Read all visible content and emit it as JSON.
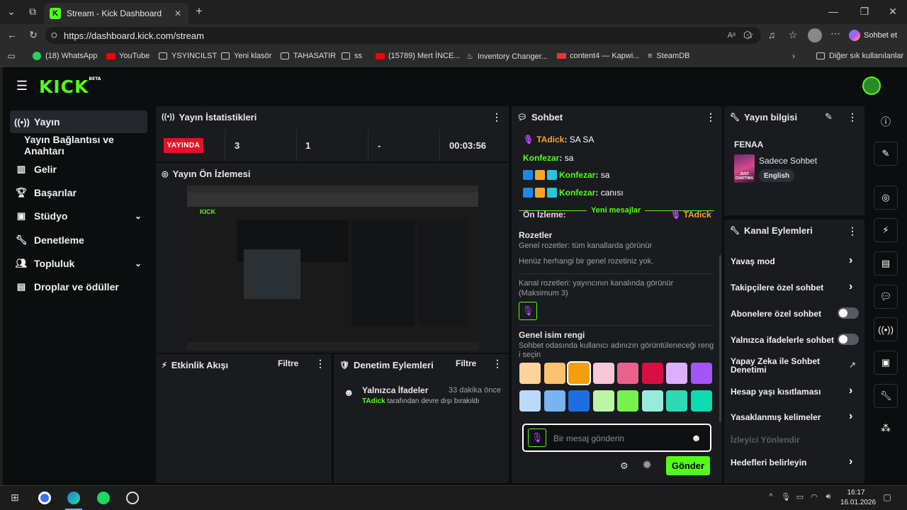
{
  "browser": {
    "tab_title": "Stream - Kick Dashboard",
    "url": "https://dashboard.kick.com/stream",
    "copilot_label": "Sohbet et",
    "bookmarks": [
      "(18) WhatsApp",
      "YouTube",
      "YSYINCILST",
      "Yeni klasör",
      "TAHASATIR",
      "ss",
      "(15789) Mert İNCE...",
      "Inventory Changer...",
      "content4 — Kapwi...",
      "SteamDB"
    ],
    "other_bookmarks": "Diğer sık kullanılanlar"
  },
  "logo": {
    "text": "KICK",
    "beta": "BETA"
  },
  "sidebar": {
    "items": [
      {
        "label": "Yayın",
        "icon": "broadcast-icon"
      },
      {
        "label": "Yayın Bağlantısı ve Anahtarı"
      },
      {
        "label": "Gelir",
        "icon": "chart-icon"
      },
      {
        "label": "Başarılar",
        "icon": "trophy-icon"
      },
      {
        "label": "Stüdyo",
        "icon": "studio-icon"
      },
      {
        "label": "Denetleme",
        "icon": "wrench-icon"
      },
      {
        "label": "Topluluk",
        "icon": "people-icon"
      },
      {
        "label": "Droplar ve ödüller",
        "icon": "gift-icon"
      }
    ]
  },
  "stats": {
    "title": "Yayın İstatistikleri",
    "live_label": "YAYINDA",
    "values": [
      "3",
      "1",
      "-",
      "00:03:56"
    ]
  },
  "preview": {
    "title": "Yayın Ön İzlemesi"
  },
  "activity": {
    "title": "Etkinlik Akışı",
    "filter": "Filtre"
  },
  "moderation": {
    "title": "Denetim Eylemleri",
    "filter": "Filtre",
    "item_title": "Yalnızca İfadeler",
    "item_time": "33 dakika önce",
    "item_user": "TAdick",
    "item_desc": "tarafından devre dışı bırakıldı"
  },
  "chat": {
    "title": "Sohbet",
    "messages": [
      {
        "user": "TAdick",
        "text": "SA SA",
        "color": "#f5a623"
      },
      {
        "user": "Konfezar",
        "text": "sa",
        "color": "#53fc18"
      },
      {
        "user": "Konfezar",
        "text": "sa",
        "color": "#53fc18"
      },
      {
        "user": "Konfezar",
        "text": "canısı",
        "color": "#53fc18"
      }
    ],
    "preview_label": "Ön İzleme:",
    "new_messages": "Yeni mesajlar",
    "preview_user": "TAdick",
    "badges_title": "Rozetler",
    "badges_global_desc": "Genel rozetler: tüm kanallarda görünür",
    "badges_global_empty": "Henüz herhangi bir genel rozetiniz yok.",
    "badges_channel_desc": "Kanal rozetleri: yayıncının kanalında görünür (Maksimum 3)",
    "name_color_title": "Genel isim rengi",
    "name_color_desc": "Sohbet odasında kullanıcı adınızın görüntüleneceği reng i seçin",
    "colors": [
      "#fcd49b",
      "#f8c271",
      "#f29f0e",
      "#f9c8d7",
      "#e9628b",
      "#d70f45",
      "#ddb0fb",
      "#a355f9",
      "#bcd9fa",
      "#78b3f2",
      "#1d6fe0",
      "#bdf5a7",
      "#76f14d",
      "#97ebdd",
      "#2ed9b5",
      "#0ddcb1"
    ],
    "input_placeholder": "Bir mesaj gönderin",
    "send_label": "Gönder"
  },
  "stream_info": {
    "title": "Yayın bilgisi",
    "stream_title": "FENAA",
    "category": "Sadece Sohbet",
    "language": "English",
    "thumb_text": "JUST CHATTING"
  },
  "channel_actions": {
    "title": "Kanal Eylemleri",
    "items": [
      {
        "label": "Yavaş mod",
        "type": "chevron"
      },
      {
        "label": "Takipçilere özel sohbet",
        "type": "chevron"
      },
      {
        "label": "Abonelere özel sohbet",
        "type": "toggle"
      },
      {
        "label": "Yalnızca ifadelerle sohbet",
        "type": "toggle"
      },
      {
        "label": "Yapay Zeka ile Sohbet Denetimi",
        "type": "external"
      },
      {
        "label": "Hesap yaşı kısıtlaması",
        "type": "chevron"
      },
      {
        "label": "Yasaklanmış kelimeler",
        "type": "chevron"
      },
      {
        "label": "İzleyici Yönlendir",
        "type": "disabled"
      },
      {
        "label": "Hedefleri belirleyin",
        "type": "chevron"
      }
    ]
  },
  "taskbar": {
    "time": "16:17",
    "date": "16.01.2026"
  }
}
